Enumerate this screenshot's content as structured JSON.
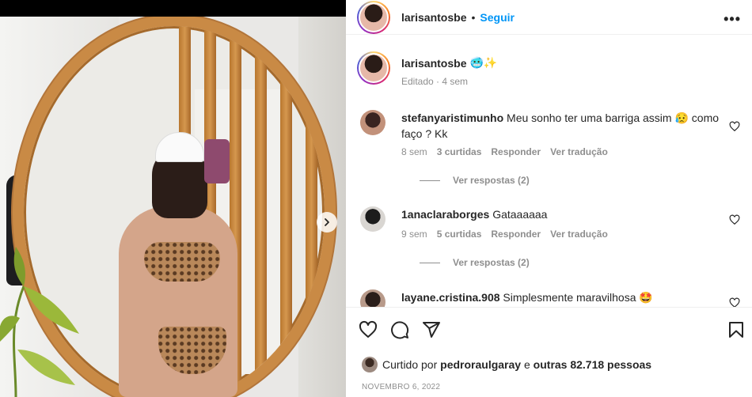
{
  "header": {
    "username": "larisantosbe",
    "separator": "•",
    "follow_label": "Seguir",
    "more_label": "•••"
  },
  "caption": {
    "username": "larisantosbe",
    "emojis": "🥶✨",
    "edited": "Editado · 4 sem"
  },
  "comments": [
    {
      "username": "stefanyaristimunho",
      "text": "Meu sonho ter uma barriga assim 😥 como faço ? Kk",
      "time": "8 sem",
      "likes": "3 curtidas",
      "reply": "Responder",
      "translate": "Ver tradução",
      "replies": "Ver respostas (2)"
    },
    {
      "username": "1anaclaraborges",
      "text": "Gataaaaaa",
      "time": "9 sem",
      "likes": "5 curtidas",
      "reply": "Responder",
      "translate": "Ver tradução",
      "replies": "Ver respostas (2)"
    },
    {
      "username": "layane.cristina.908",
      "text": "Simplesmente maravilhosa 🤩"
    }
  ],
  "footer": {
    "liked_prefix": "Curtido por",
    "liked_user": "pedroraulgaray",
    "liked_mid": "e",
    "liked_others": "outras 82.718 pessoas",
    "date": "NOVEMBRO 6, 2022"
  },
  "colors": {
    "link": "#0095f6",
    "muted": "#8e8e8e",
    "text": "#262626"
  },
  "icons": [
    "chevron-right-icon",
    "more-icon",
    "heart-icon",
    "comment-icon",
    "share-icon",
    "bookmark-icon"
  ]
}
